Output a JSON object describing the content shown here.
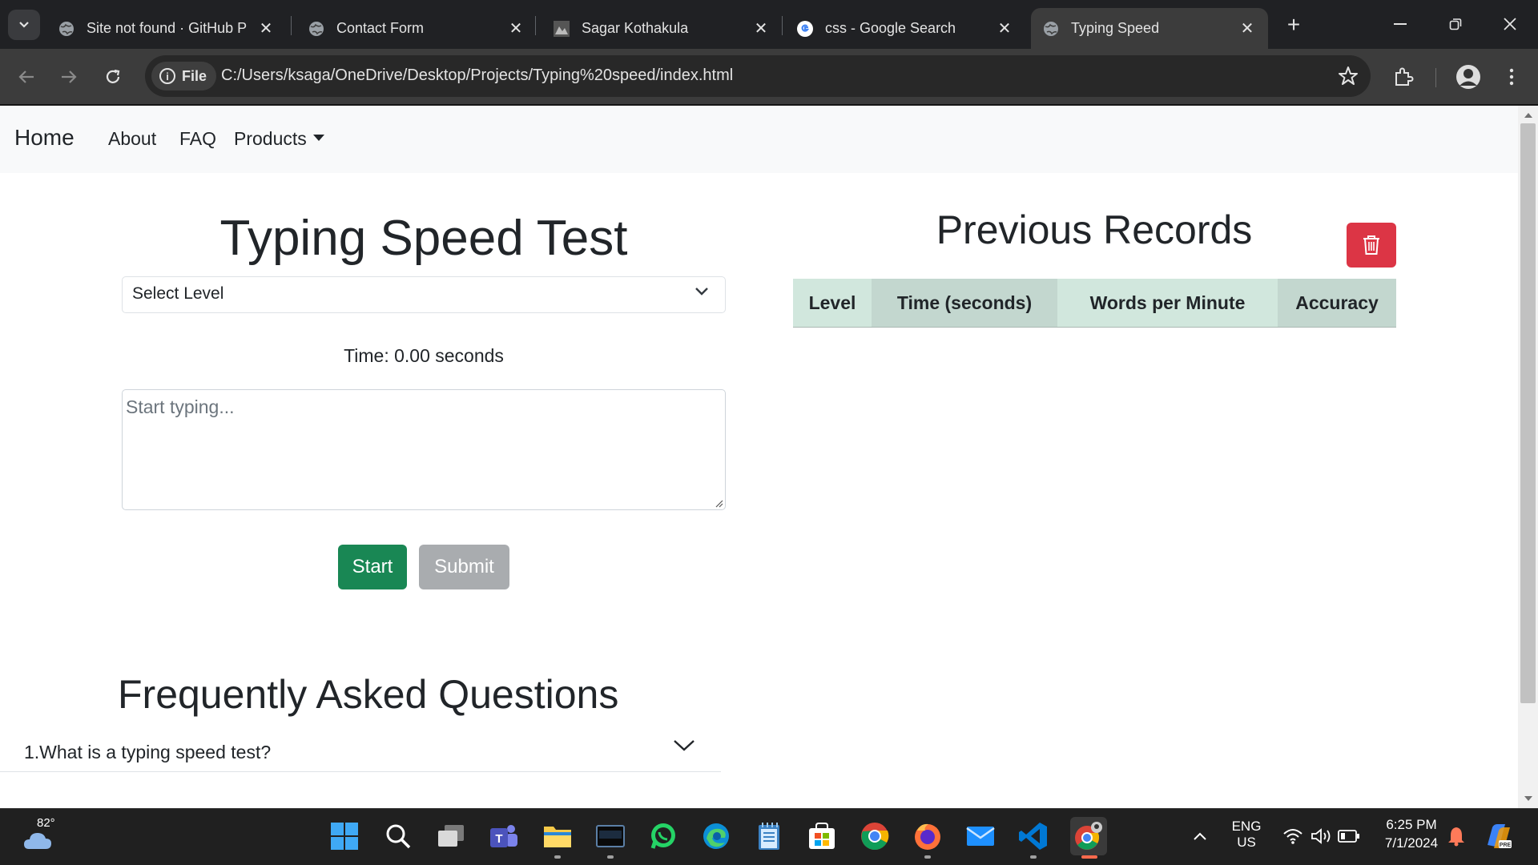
{
  "browser": {
    "tabs": [
      {
        "title": "Site not found · GitHub P",
        "active": false
      },
      {
        "title": "Contact Form",
        "active": false
      },
      {
        "title": "Sagar Kothakula",
        "active": false
      },
      {
        "title": "css - Google Search",
        "active": false
      },
      {
        "title": "Typing Speed",
        "active": true
      }
    ],
    "address": {
      "scheme_chip": "File",
      "url": "C:/Users/ksaga/OneDrive/Desktop/Projects/Typing%20speed/index.html"
    }
  },
  "page": {
    "navbar": {
      "brand": "Home",
      "links": [
        "About",
        "FAQ",
        "Products"
      ]
    },
    "typing": {
      "title": "Typing Speed Test",
      "level_select": "Select Level",
      "time_text": "Time: 0.00 seconds",
      "textarea_placeholder": "Start typing...",
      "start_label": "Start",
      "submit_label": "Submit"
    },
    "records": {
      "title": "Previous Records",
      "columns": [
        "Level",
        "Time (seconds)",
        "Words per Minute",
        "Accuracy"
      ]
    },
    "faq": {
      "title": "Frequently Asked Questions",
      "items": [
        "1.What is a typing speed test?"
      ]
    }
  },
  "taskbar": {
    "weather_temp": "82°",
    "language": "ENG",
    "region": "US",
    "time": "6:25 PM",
    "date": "7/1/2024"
  },
  "colors": {
    "start_button": "#198754",
    "submit_button": "#a9acaf",
    "trash_button": "#dc3545",
    "table_header_a": "#d1e7dd",
    "table_header_b": "#c3d7cf"
  }
}
